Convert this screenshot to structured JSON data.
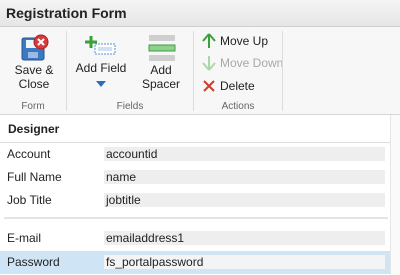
{
  "window": {
    "title": "Registration Form"
  },
  "ribbon": {
    "groups": {
      "form": {
        "label": "Form",
        "save_close": [
          "Save &",
          "Close"
        ]
      },
      "fields": {
        "label": "Fields",
        "add_field": "Add Field",
        "add_spacer": [
          "Add",
          "Spacer"
        ]
      },
      "actions": {
        "label": "Actions",
        "move_up": "Move Up",
        "move_down": "Move Down",
        "delete": "Delete"
      }
    }
  },
  "designer": {
    "title": "Designer",
    "rows": [
      {
        "label": "Account",
        "value": "accountid"
      },
      {
        "label": "Full Name",
        "value": "name"
      },
      {
        "label": "Job Title",
        "value": "jobtitle"
      },
      {
        "label": "E-mail",
        "value": "emailaddress1"
      },
      {
        "label": "Password",
        "value": "fs_portalpassword",
        "selected": true
      }
    ]
  },
  "colors": {
    "accent_blue": "#2e6fb8",
    "selected_row": "#cfe5f5",
    "move_up_green": "#3aa23a",
    "delete_red": "#d23a2a"
  }
}
